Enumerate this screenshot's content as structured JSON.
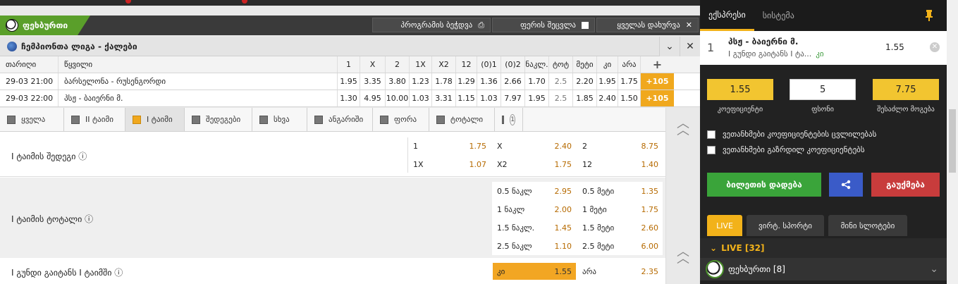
{
  "sport_header": {
    "sport": "ფეხბურთი",
    "print_program": "პროგრამის ბეჭდვა",
    "change_color": "ფერის შეცვლა",
    "collapse_all": "ყველას დახურვა"
  },
  "league": {
    "name": "ჩემპიონთა ლიგა - ქალები"
  },
  "table": {
    "headers": [
      "თარიღი",
      "წყვილი",
      "1",
      "X",
      "2",
      "1X",
      "X2",
      "12",
      "(0)1",
      "(0)2",
      "ნაკლ.",
      "ტოტ",
      "მეტი",
      "კი",
      "არა",
      "+"
    ],
    "rows": [
      {
        "date": "29-03 21:00",
        "pair": "ბარსელონა - რუსენგორდი",
        "odds": [
          "1.95",
          "3.35",
          "3.80",
          "1.23",
          "1.78",
          "1.29",
          "1.36",
          "2.66",
          "1.70",
          "2.5",
          "2.20",
          "1.95",
          "1.75"
        ],
        "more": "+105"
      },
      {
        "date": "29-03 22:00",
        "pair": "პსჟ - ბაიერნი მ.",
        "odds": [
          "1.30",
          "4.95",
          "10.00",
          "1.03",
          "3.31",
          "1.15",
          "1.03",
          "7.97",
          "1.95",
          "2.5",
          "1.85",
          "2.40",
          "1.50"
        ],
        "more": "+105"
      }
    ]
  },
  "market_tabs": [
    {
      "label": "ყველა",
      "active": false
    },
    {
      "label": "II ტაიმი",
      "active": false
    },
    {
      "label": "I ტაიმი",
      "active": true
    },
    {
      "label": "შედეგები",
      "active": false
    },
    {
      "label": "სხვა",
      "active": false
    },
    {
      "label": "ანგარიში",
      "active": false
    },
    {
      "label": "ფორა",
      "active": false
    },
    {
      "label": "ტოტალი",
      "active": false
    },
    {
      "label": "",
      "badge": "1",
      "active": false
    }
  ],
  "markets": {
    "result": {
      "title": "I ტაიმის შედეგი ⓘ",
      "outcomes": [
        {
          "name": "1",
          "odd": "1.75"
        },
        {
          "name": "X",
          "odd": "2.40"
        },
        {
          "name": "2",
          "odd": "8.75"
        },
        {
          "name": "1X",
          "odd": "1.07"
        },
        {
          "name": "X2",
          "odd": "1.75"
        },
        {
          "name": "12",
          "odd": "1.40"
        }
      ]
    },
    "total": {
      "title": "I ტაიმის ტოტალი ⓘ",
      "outcomes": [
        {
          "name": "0.5 ნაკლ",
          "odd": "2.95"
        },
        {
          "name": "0.5 მეტი",
          "odd": "1.35"
        },
        {
          "name": "1 ნაკლ",
          "odd": "2.00"
        },
        {
          "name": "1 მეტი",
          "odd": "1.75"
        },
        {
          "name": "1.5 ნაკლ.",
          "odd": "1.45"
        },
        {
          "name": "1.5 მეტი",
          "odd": "2.60"
        },
        {
          "name": "2.5 ნაკლ",
          "odd": "1.10"
        },
        {
          "name": "2.5 მეტი",
          "odd": "6.00"
        }
      ]
    },
    "team_scores": {
      "title": "I გუნდი გაიტანს I ტაიმში ⓘ",
      "outcomes": [
        {
          "name": "კი",
          "odd": "1.55",
          "selected": true
        },
        {
          "name": "არა",
          "odd": "2.35"
        }
      ]
    }
  },
  "betslip": {
    "tabs": [
      "ექსპრესი",
      "სისტემა"
    ],
    "item": {
      "index": "1",
      "event": "პსჟ - ბაიერნი მ.",
      "market": "I გუნდი გაიტანს I ტა...",
      "pick": "კი",
      "odd": "1.55"
    },
    "coef": "1.55",
    "stake": "5",
    "win": "7.75",
    "coef_label": "კოეფიციენტი",
    "stake_label": "ფსონი",
    "win_label": "შესაძლო მოგება",
    "opt1": "ვეთანხმები კოეფიციენტების ცვლილებას",
    "opt2": "ვეთანხმები გაზრდილ კოეფიციენტებს",
    "place_bet": "ბილეთის დადება",
    "cancel": "გაუქმება"
  },
  "live": {
    "tabs": [
      "LIVE",
      "ვირტ. სპორტი",
      "მინი სლოტები"
    ],
    "label": "LIVE [32]",
    "sport": "ფეხბურთი [8]"
  },
  "colors": {
    "accent": "#f2a623",
    "green": "#3aa43a",
    "red": "#c83c3c",
    "blue": "#3a5bc8"
  }
}
